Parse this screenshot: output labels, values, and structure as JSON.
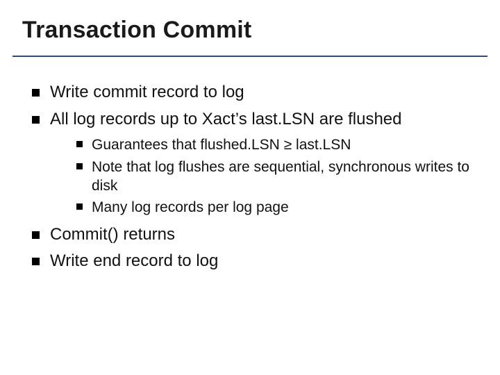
{
  "title": "Transaction Commit",
  "bullets": {
    "b1": "Write commit record to log",
    "b2": "All log records up to Xact’s last.LSN are flushed",
    "b2_sub": {
      "s1_pre": "Guarantees that flushed.LSN ",
      "s1_sym": "≥",
      "s1_post": " last.LSN",
      "s2": "Note that log flushes are sequential, synchronous writes to disk",
      "s3": "Many log records per log page"
    },
    "b3": "Commit() returns",
    "b4": "Write end record to log"
  }
}
